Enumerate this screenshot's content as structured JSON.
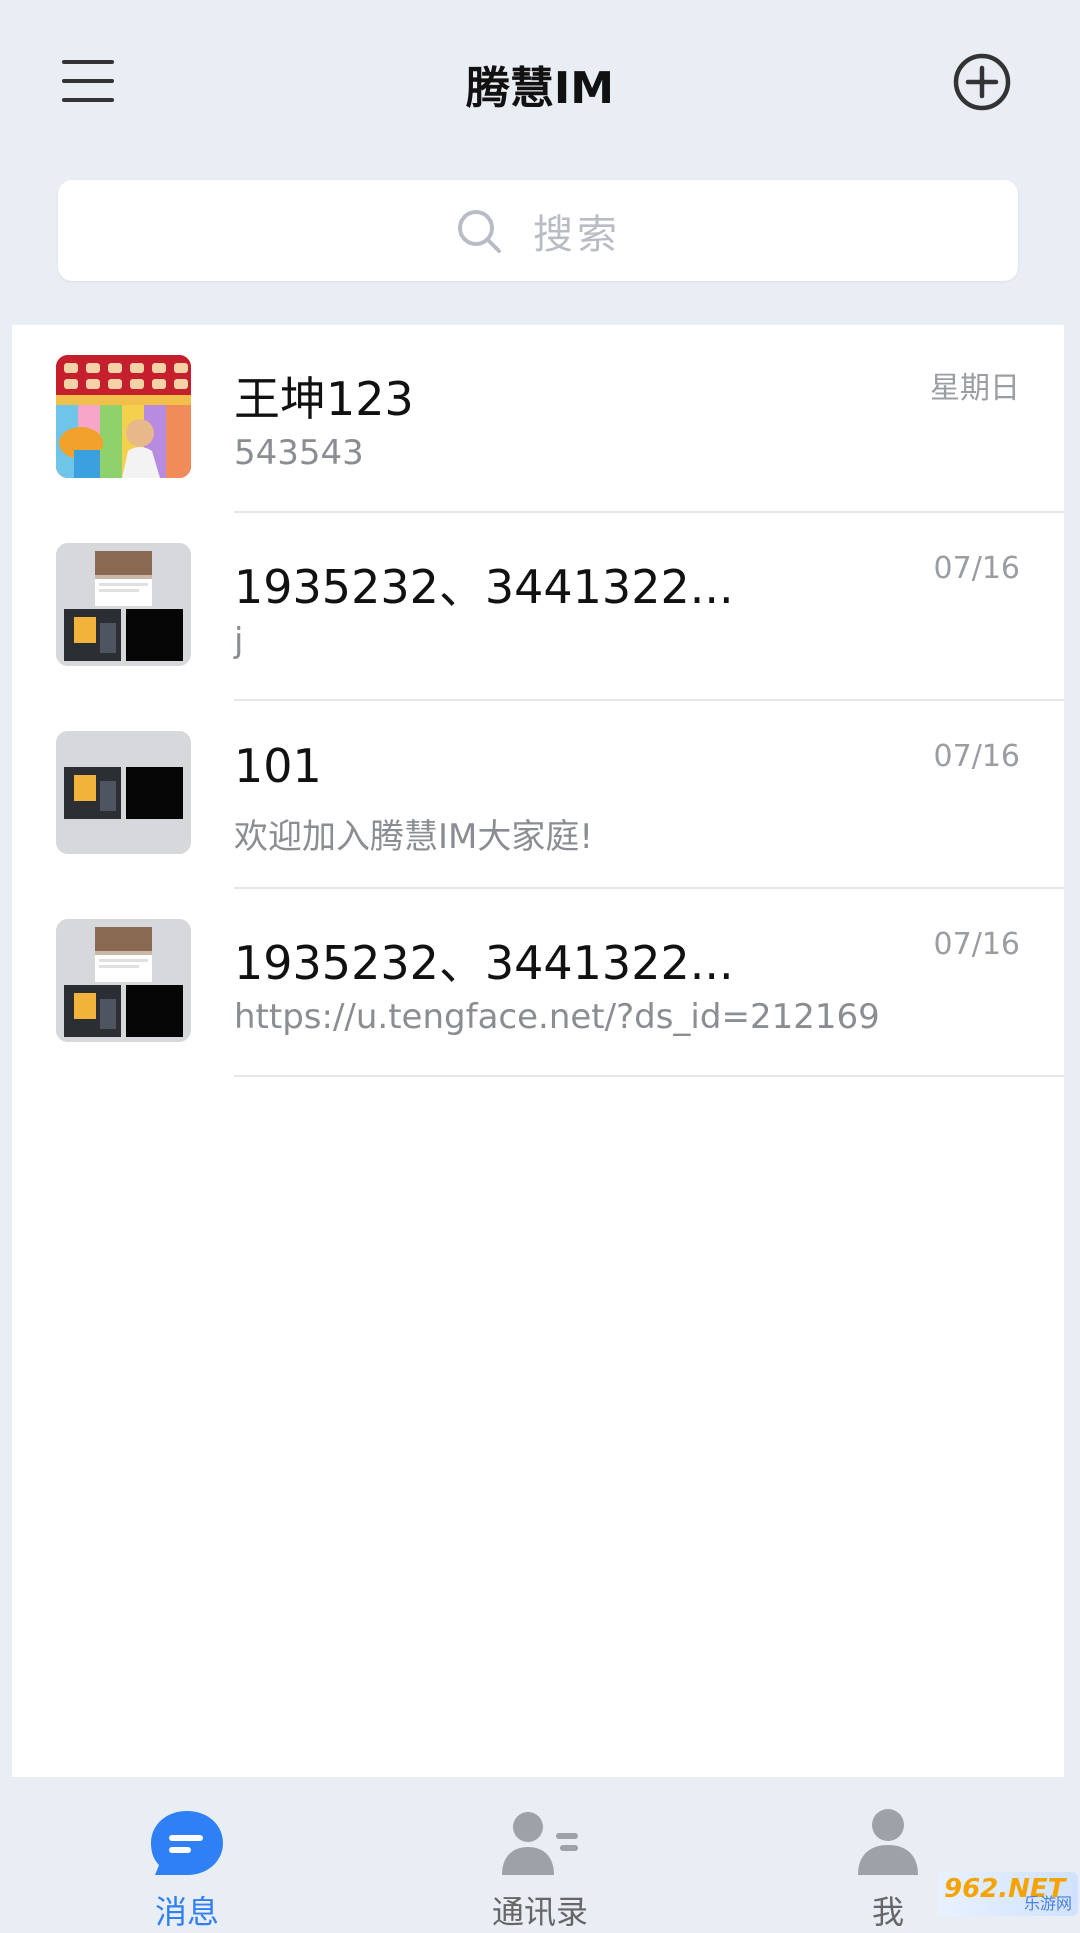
{
  "header": {
    "title": "腾慧IM"
  },
  "search": {
    "placeholder": "搜索"
  },
  "conversations": [
    {
      "name": "王坤123",
      "preview": "543543",
      "time": "星期日"
    },
    {
      "name": "1935232、3441322...",
      "preview": "j",
      "time": "07/16"
    },
    {
      "name": "101",
      "preview": "欢迎加入腾慧IM大家庭!",
      "time": "07/16"
    },
    {
      "name": "1935232、3441322...",
      "preview": "https://u.tengface.net/?ds_id=212169",
      "time": "07/16"
    }
  ],
  "tabs": [
    {
      "label": "消息",
      "active": true
    },
    {
      "label": "通讯录",
      "active": false
    },
    {
      "label": "我",
      "active": false
    }
  ],
  "colors": {
    "accent": "#2f7ff5",
    "inactive": "#9da2a8",
    "background": "#e9edf4"
  },
  "watermark": {
    "main": "962.NET",
    "sub": "乐游网"
  }
}
